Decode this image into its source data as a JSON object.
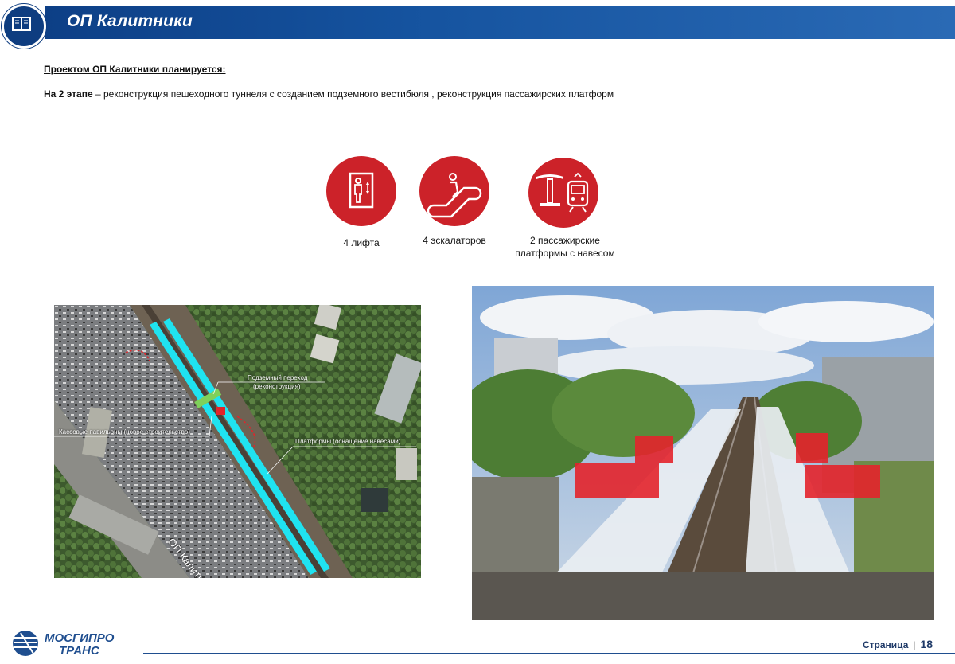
{
  "header": {
    "title": "ОП Калитники"
  },
  "intro": "Проектом ОП Калитники планируется:",
  "stage": {
    "label": "На 2 этапе",
    "text": " – реконструкция пешеходного туннеля с созданием подземного вестибюля , реконструкция пассажирских платформ"
  },
  "features": [
    {
      "icon": "elevator-icon",
      "label": "4 лифта"
    },
    {
      "icon": "escalator-icon",
      "label": "4 эскалаторов"
    },
    {
      "icon": "platform-train-icon",
      "label_line1": "2 пассажирские",
      "label_line2": "платформы с навесом"
    }
  ],
  "map": {
    "labels": {
      "underpass_line1": "Подземный переход",
      "underpass_line2": "(реконструкция)",
      "kiosks": "Кассовые павильоны (новое строительство)",
      "platforms": "Платформы (оснащение навесами)",
      "street": "ОП Калитники"
    }
  },
  "footer": {
    "logo_line1": "МОСГИПРО",
    "logo_line2": "ТРАНС",
    "page_label": "Страница",
    "page_number": "18"
  },
  "colors": {
    "header_blue": "#15539f",
    "accent_red": "#cc2229",
    "platform_cyan": "#1fe3f0"
  }
}
